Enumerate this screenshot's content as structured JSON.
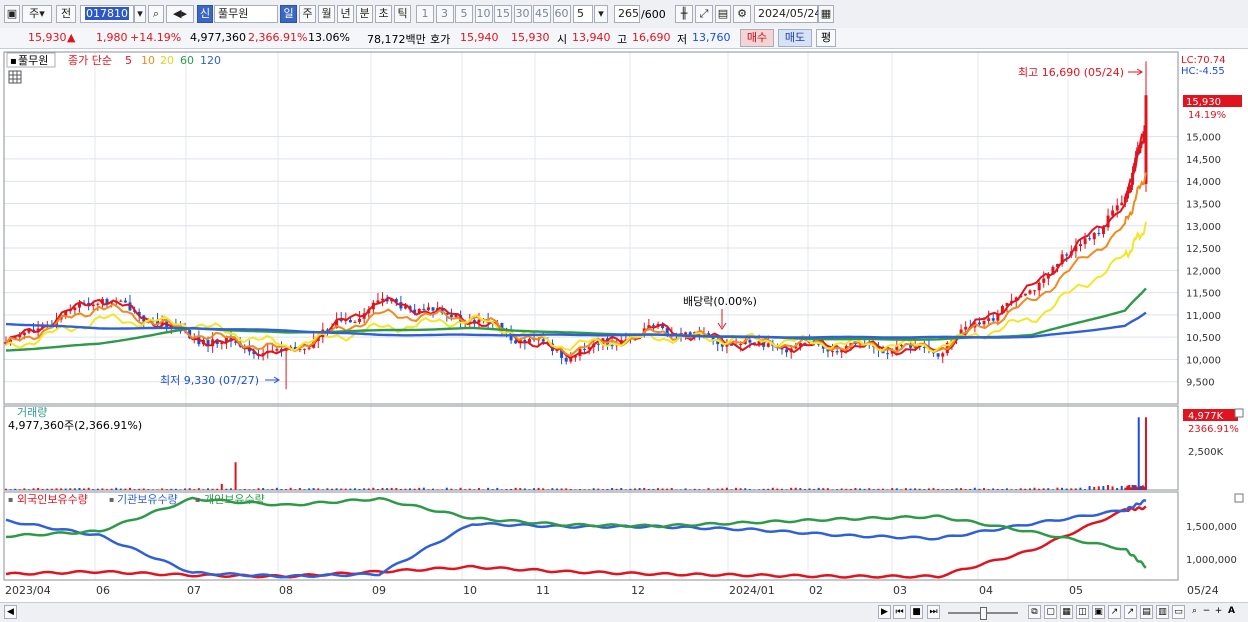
{
  "toolbar": {
    "period_selector": "주",
    "prev_label": "전",
    "stock_code": "017810",
    "badge_new": "신",
    "stock_name": "풀무원",
    "period_buttons": [
      "일",
      "주",
      "월",
      "년",
      "분",
      "초",
      "틱"
    ],
    "interval_buttons": [
      "1",
      "3",
      "5",
      "10",
      "15",
      "30",
      "45",
      "60"
    ],
    "interval_value": "5",
    "count_value": "265",
    "count_max": "/600",
    "date_value": "2024/05/24"
  },
  "quote": {
    "price": "15,930",
    "change_arrow": "▲",
    "change": "1,980",
    "change_pct": "+14.19%",
    "volume": "4,977,360",
    "volume_ratio": "2,366.91%",
    "turnover_rate": "13.06%",
    "trade_value": "78,172백만",
    "bid_label": "호가",
    "ask_price": "15,940",
    "bid_price": "15,930",
    "open_label": "시",
    "open_price": "13,940",
    "high_label": "고",
    "high_price": "16,690",
    "low_label": "저",
    "low_price": "13,760",
    "buy_button": "매수",
    "sell_button": "매도",
    "eval_button": "평"
  },
  "colors": {
    "up": "#e0141e",
    "down": "#1a4fd6",
    "ma5": "#e0141e",
    "ma10": "#ee8a1e",
    "ma20": "#f2e62a",
    "ma60": "#2e9a48",
    "ma120": "#3060d8"
  },
  "chart_data": [
    {
      "type": "line",
      "panel": "price",
      "legend_title": "풀무원",
      "legend_items": [
        "종가 단순",
        "5",
        "10",
        "20",
        "60",
        "120"
      ],
      "x_ticks": [
        "2023/04",
        "06",
        "07",
        "08",
        "09",
        "10",
        "11",
        "12",
        "2024/01",
        "02",
        "03",
        "04",
        "05",
        "05/24"
      ],
      "y_ticks": [
        9500,
        10000,
        10500,
        11000,
        11500,
        12000,
        12500,
        13000,
        13500,
        14000,
        14500,
        15000
      ],
      "ylim": [
        9000,
        16900
      ],
      "series": [
        {
          "name": "5",
          "x": [
            "2023/04",
            "06",
            "07",
            "08",
            "09",
            "10",
            "11",
            "12",
            "2024/01",
            "02",
            "03",
            "04",
            "05",
            "05/24"
          ],
          "values": [
            10350,
            11400,
            10500,
            10100,
            11300,
            10900,
            10100,
            10700,
            10300,
            10300,
            10200,
            11600,
            13500,
            15300
          ]
        },
        {
          "name": "10",
          "x": [
            "2023/04",
            "06",
            "07",
            "08",
            "09",
            "10",
            "11",
            "12",
            "2024/01",
            "02",
            "03",
            "04",
            "05",
            "05/24"
          ],
          "values": [
            10300,
            11200,
            10600,
            10200,
            11000,
            10950,
            10200,
            10600,
            10400,
            10300,
            10250,
            11300,
            13000,
            14200
          ]
        },
        {
          "name": "20",
          "x": [
            "2023/04",
            "06",
            "07",
            "08",
            "09",
            "10",
            "11",
            "12",
            "2024/01",
            "02",
            "03",
            "04",
            "05",
            "05/24"
          ],
          "values": [
            10250,
            10900,
            10800,
            10300,
            10700,
            10900,
            10300,
            10500,
            10450,
            10350,
            10300,
            10900,
            12300,
            13000
          ]
        },
        {
          "name": "60",
          "x": [
            "2023/04",
            "06",
            "07",
            "08",
            "09",
            "10",
            "11",
            "12",
            "2024/01",
            "02",
            "03",
            "04",
            "05",
            "05/24"
          ],
          "values": [
            10200,
            10350,
            10700,
            10600,
            10650,
            10700,
            10600,
            10550,
            10500,
            10450,
            10450,
            10550,
            11100,
            11600
          ]
        },
        {
          "name": "120",
          "x": [
            "2023/04",
            "06",
            "07",
            "08",
            "09",
            "10",
            "11",
            "12",
            "2024/01",
            "02",
            "03",
            "04",
            "05",
            "05/24"
          ],
          "values": [
            10800,
            10700,
            10700,
            10650,
            10550,
            10550,
            10550,
            10550,
            10500,
            10500,
            10500,
            10500,
            10750,
            11050
          ]
        }
      ],
      "annotations": {
        "high": "최고 16,690 (05/24)",
        "low": "최저 9,330 (07/27)",
        "dividend": "배당락(0.00%)",
        "lc": "LC:70.74",
        "hc": "HC:-4.55",
        "last_price": "15,930",
        "last_pct": "14.19%"
      },
      "grid": true
    },
    {
      "type": "bar",
      "panel": "volume",
      "title": "거래량",
      "info": "4,977,360주(2,366.91%)",
      "y_ticks": [
        "2,500K"
      ],
      "last_value_label": "4,977K",
      "last_pct_label": "2366.91%",
      "highlights": [
        {
          "x": "06",
          "value": 1900000
        },
        {
          "x": "05",
          "value": 4977360
        },
        {
          "x": "05/24",
          "value": 4977360
        }
      ]
    },
    {
      "type": "line",
      "panel": "holdings",
      "legend_items": [
        "외국인보유수량",
        "기관보유수량",
        "개인보유수량"
      ],
      "y_ticks": [
        "1,500,000",
        "1,000,000"
      ],
      "series": [
        {
          "name": "외국인보유수량",
          "x": [
            "2023/04",
            "06",
            "07",
            "08",
            "09",
            "10",
            "11",
            "12",
            "2024/01",
            "02",
            "03",
            "04",
            "05",
            "05/24"
          ],
          "values": [
            600000,
            640000,
            580000,
            560000,
            640000,
            720000,
            640000,
            600000,
            580000,
            560000,
            560000,
            1000000,
            1680000,
            1720000
          ]
        },
        {
          "name": "기관보유수량",
          "x": [
            "2023/04",
            "06",
            "07",
            "08",
            "09",
            "10",
            "11",
            "12",
            "2024/01",
            "02",
            "03",
            "04",
            "05",
            "05/24"
          ],
          "values": [
            1500000,
            1250000,
            620000,
            560000,
            600000,
            1450000,
            1400000,
            1400000,
            1350000,
            1250000,
            1200000,
            1450000,
            1680000,
            1840000
          ]
        },
        {
          "name": "개인보유수량",
          "x": [
            "2023/04",
            "06",
            "07",
            "08",
            "09",
            "10",
            "11",
            "12",
            "2024/01",
            "02",
            "03",
            "04",
            "05",
            "05/24"
          ],
          "values": [
            1240000,
            1320000,
            1870000,
            1760000,
            1870000,
            1540000,
            1430000,
            1410000,
            1470000,
            1530000,
            1570000,
            1310000,
            1020000,
            720000
          ]
        }
      ]
    }
  ]
}
